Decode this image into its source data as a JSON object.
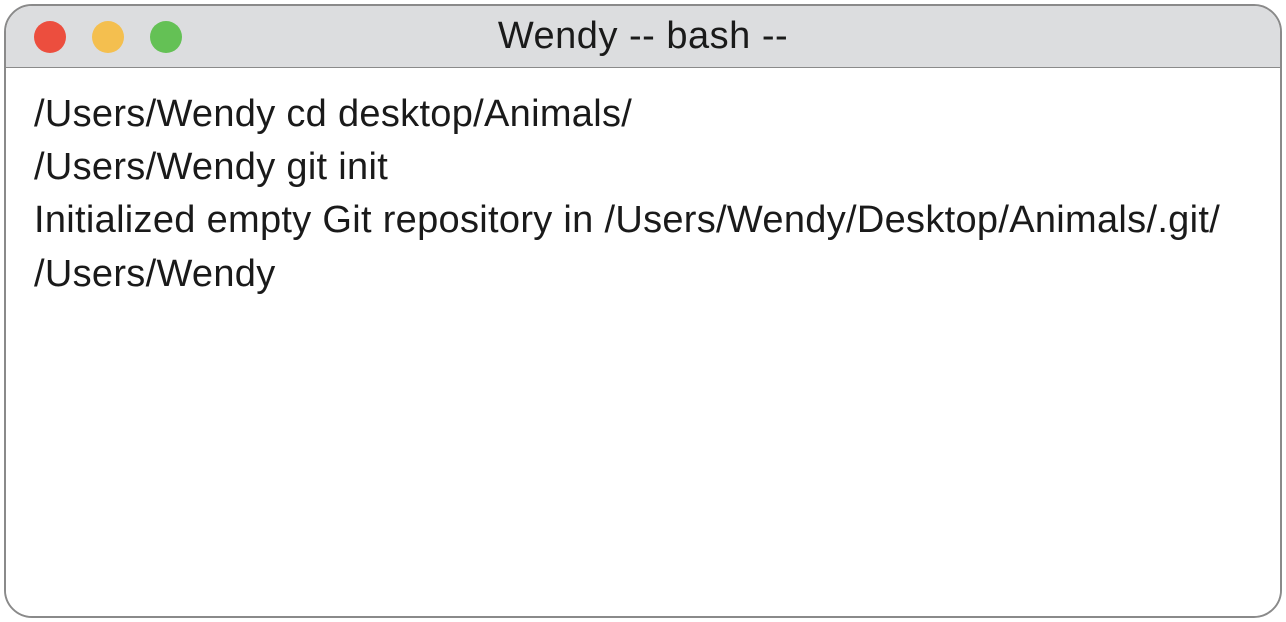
{
  "window": {
    "title": "Wendy -- bash --",
    "traffic_lights": {
      "red": "#ec4e3e",
      "yellow": "#f4bf4f",
      "green": "#64c155"
    }
  },
  "terminal": {
    "lines": [
      "/Users/Wendy cd desktop/Animals/",
      "/Users/Wendy git init",
      "Initialized empty Git repository in /Users/Wendy/Desktop/Animals/.git/",
      "/Users/Wendy"
    ]
  }
}
